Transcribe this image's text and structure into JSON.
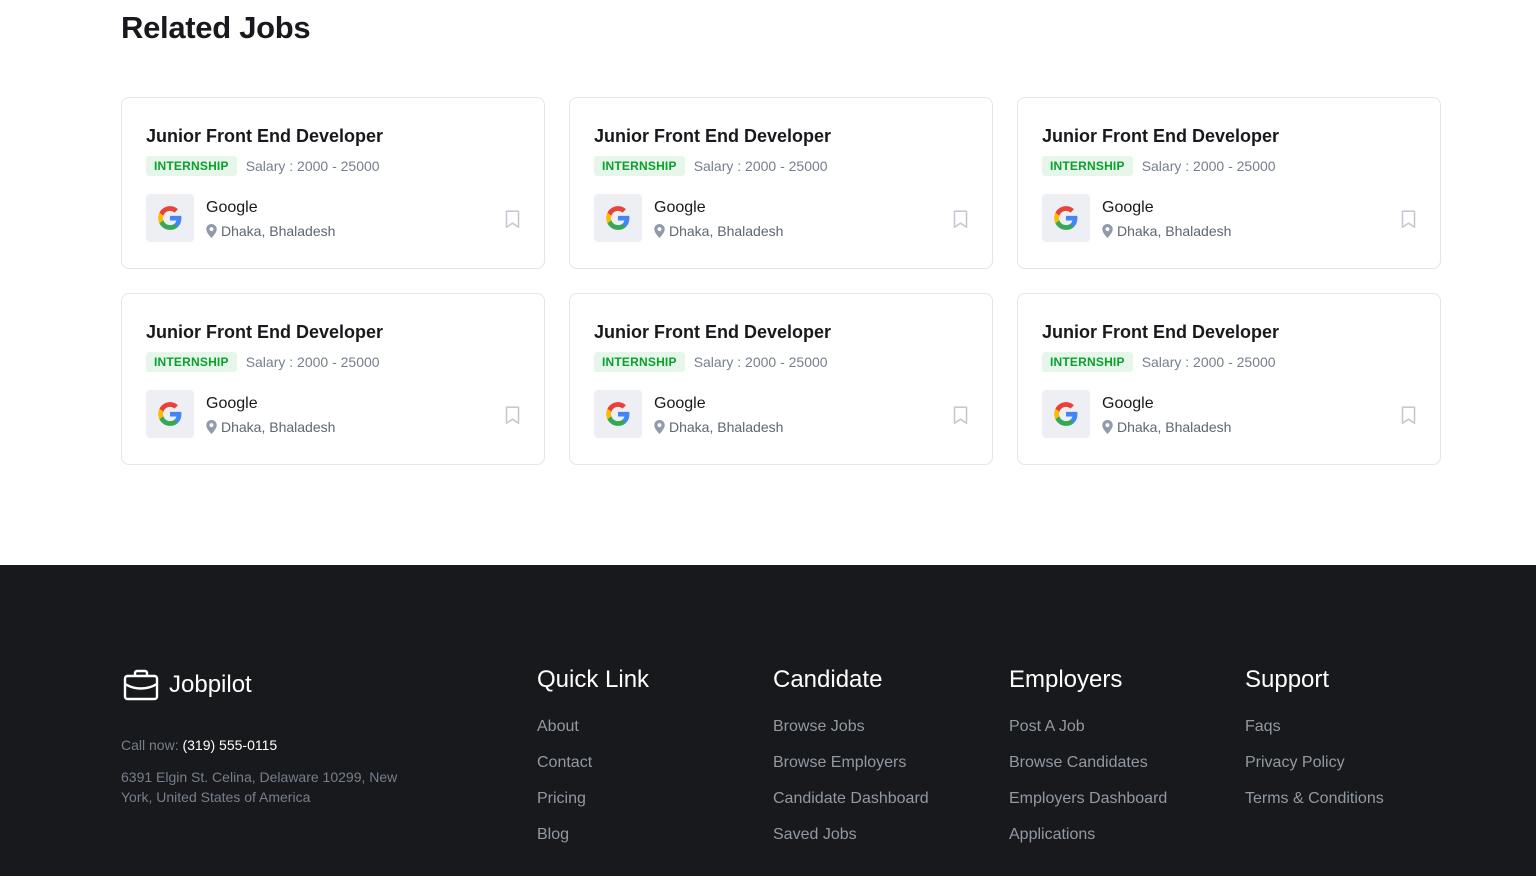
{
  "related": {
    "title": "Related Jobs",
    "jobs": [
      {
        "title": "Junior Front End Developer",
        "type": "INTERNSHIP",
        "salary": "Salary : 2000 - 25000",
        "company": "Google",
        "location": "Dhaka, Bhaladesh"
      },
      {
        "title": "Junior Front End Developer",
        "type": "INTERNSHIP",
        "salary": "Salary : 2000 - 25000",
        "company": "Google",
        "location": "Dhaka, Bhaladesh"
      },
      {
        "title": "Junior Front End Developer",
        "type": "INTERNSHIP",
        "salary": "Salary : 2000 - 25000",
        "company": "Google",
        "location": "Dhaka, Bhaladesh"
      },
      {
        "title": "Junior Front End Developer",
        "type": "INTERNSHIP",
        "salary": "Salary : 2000 - 25000",
        "company": "Google",
        "location": "Dhaka, Bhaladesh"
      },
      {
        "title": "Junior Front End Developer",
        "type": "INTERNSHIP",
        "salary": "Salary : 2000 - 25000",
        "company": "Google",
        "location": "Dhaka, Bhaladesh"
      },
      {
        "title": "Junior Front End Developer",
        "type": "INTERNSHIP",
        "salary": "Salary : 2000 - 25000",
        "company": "Google",
        "location": "Dhaka, Bhaladesh"
      }
    ]
  },
  "footer": {
    "brand": "Jobpilot",
    "brand_icon": "briefcase-icon",
    "call_label": "Call now:",
    "phone": "(319) 555-0115",
    "address": "6391 Elgin St. Celina, Delaware 10299, New York, United States of America",
    "columns": [
      {
        "heading": "Quick Link",
        "links": [
          "About",
          "Contact",
          "Pricing",
          "Blog"
        ]
      },
      {
        "heading": "Candidate",
        "links": [
          "Browse Jobs",
          "Browse Employers",
          "Candidate Dashboard",
          "Saved Jobs"
        ]
      },
      {
        "heading": "Employers",
        "links": [
          "Post A Job",
          "Browse Candidates",
          "Employers Dashboard",
          "Applications"
        ]
      },
      {
        "heading": "Support",
        "links": [
          "Faqs",
          "Privacy Policy",
          "Terms & Conditions"
        ]
      }
    ]
  },
  "colors": {
    "tag_bg": "#e7f6ea",
    "tag_text": "#0ba02c",
    "footer_bg": "#18191c"
  }
}
